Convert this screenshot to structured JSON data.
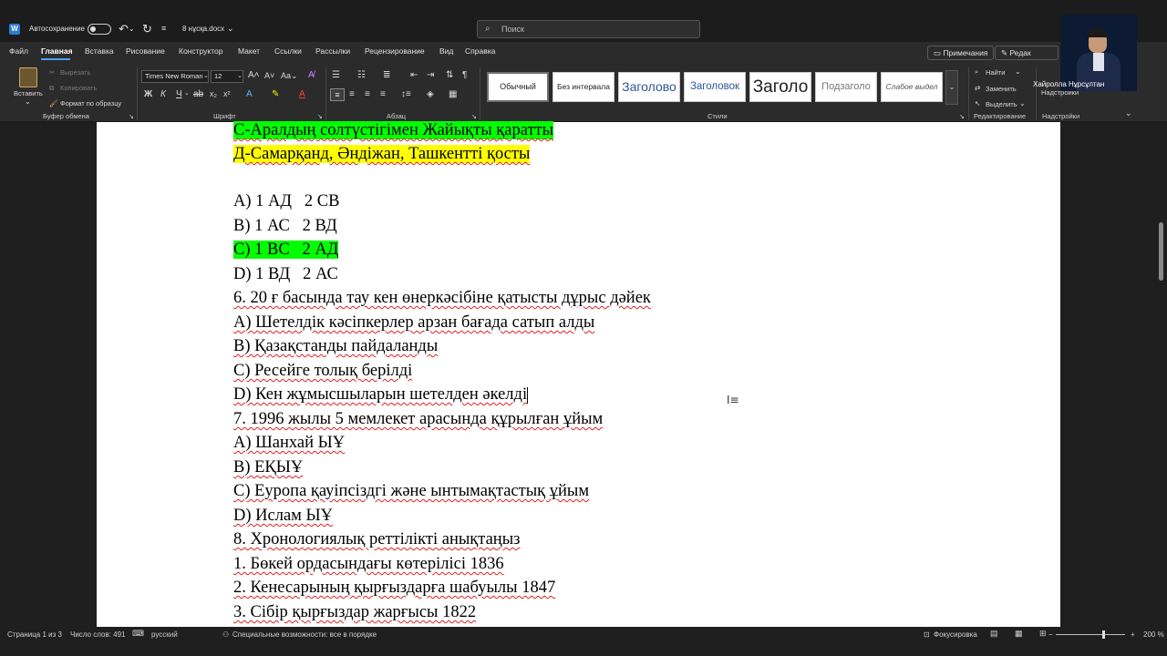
{
  "titlebar": {
    "autosave_label": "Автосохранение",
    "filename": "8 нұсқа.docx",
    "search_placeholder": "Поиск"
  },
  "menu": {
    "tabs": [
      "Файл",
      "Главная",
      "Вставка",
      "Рисование",
      "Конструктор",
      "Макет",
      "Ссылки",
      "Рассылки",
      "Рецензирование",
      "Вид",
      "Справка"
    ],
    "active_tab": "Главная",
    "comments_label": "Примечания",
    "editing_label": "Редак"
  },
  "ribbon": {
    "clipboard": {
      "paste": "Вставить",
      "cut": "Вырезать",
      "copy": "Копировать",
      "format_painter": "Формат по образцу",
      "group": "Буфер обмена"
    },
    "font": {
      "name": "Times New Roman",
      "size": "12",
      "group": "Шрифт"
    },
    "paragraph": {
      "group": "Абзац"
    },
    "styles": {
      "items": [
        "Обычный",
        "Без интервала",
        "Заголово",
        "Заголовок",
        "Заголо",
        "Подзаголо",
        "Слабое выдел"
      ],
      "group": "Стили"
    },
    "editing": {
      "find": "Найти",
      "replace": "Заменить",
      "select": "Выделить",
      "group": "Редактирование"
    },
    "addins": {
      "label": "Надстройки",
      "group": "Надстройки"
    }
  },
  "webcam": {
    "name": "Хайролла Нұрсұлтан"
  },
  "document": {
    "lines": [
      "С-Аралдың солтүстігімен Жайықты қаратты",
      "Д-Самарқанд, Әндіжан, Ташкентті қосты",
      "",
      "A) 1 АД   2 СВ",
      "B) 1 АС   2 ВД",
      "C) 1 ВС   2 АД",
      "D) 1 ВД   2 АС",
      "6. 20 ғ басында тау кен өнеркәсібіне қатысты дұрыс дәйек",
      "A) Шетелдік кәсіпкерлер арзан бағада сатып алды",
      "B) Қазақстанды пайдаланды",
      "C) Ресейге толық берілді",
      "D) Кен жұмысшыларын шетелден әкелді",
      "7. 1996 жылы 5 мемлекет арасында құрылған ұйым",
      "A) Шанхай ЫҰ",
      "B) ЕҚЫҰ",
      "C) Еуропа қауіпсіздгі және ынтымақтастық ұйым",
      "D) Ислам ЫҰ",
      "8. Хронологиялық реттілікті анықтаңыз",
      "1. Бөкей ордасындағы көтерілісі 1836",
      "2. Кенесарының қырғыздарға шабуылы 1847",
      "3. Сібір қырғыздар жарғысы 1822"
    ]
  },
  "status": {
    "page": "Страница 1 из 3",
    "words": "Число слов: 491",
    "language": "русский",
    "accessibility": "Специальные возможности: все в порядке",
    "focus": "Фокусировка",
    "zoom": "200 %",
    "zoom_level": 0.68
  },
  "colors": {
    "highlight_green": "#00ff00",
    "highlight_yellow": "#ffff00",
    "accent": "#4ea0ff"
  }
}
